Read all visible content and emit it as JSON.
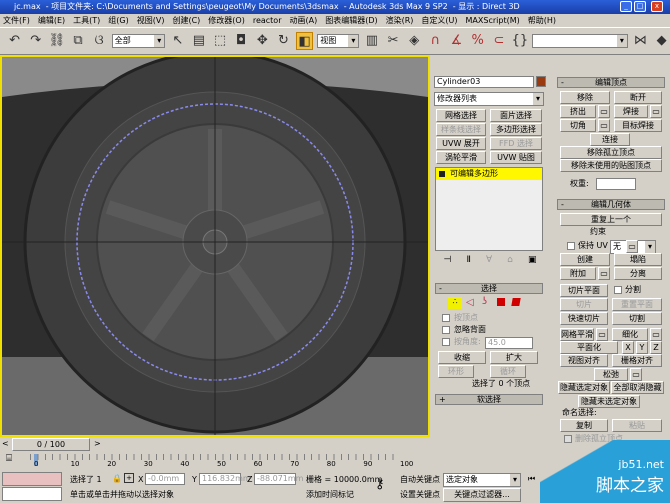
{
  "title": {
    "file": "jc.max",
    "project": "- 项目文件夹: C:\\Documents and Settings\\peugeot\\My Documents\\3dsmax",
    "app": "- Autodesk 3ds Max 9 SP2",
    "display": "- 显示 : Direct 3D"
  },
  "menu": [
    "文件(F)",
    "编辑(E)",
    "工具(T)",
    "组(G)",
    "视图(V)",
    "创建(C)",
    "修改器(O)",
    "reactor",
    "动画(A)",
    "图表编辑器(D)",
    "渲染(R)",
    "自定义(U)",
    "MAXScript(M)",
    "帮助(H)"
  ],
  "toolbar": {
    "selection_filter": "全部",
    "coord_system": "视图",
    "named_selection": ""
  },
  "modify": {
    "object_name": "Cylinder03",
    "object_color": "#9a3a10",
    "modifier_list": "修改器列表",
    "buttons": [
      "网格选择",
      "面片选择",
      "样条线选择",
      "多边形选择",
      "UVW 展开",
      "FFD 选择",
      "涡轮平滑",
      "UVW 贴图"
    ],
    "stack_item": "可编辑多边形"
  },
  "selection": {
    "title": "选择",
    "by_vertex": "按顶点",
    "ignore_backfacing": "忽略背面",
    "by_angle": "按角度:",
    "angle_value": "45.0",
    "shrink": "收缩",
    "grow": "扩大",
    "ring": "环形",
    "loop": "循环",
    "status": "选择了 0 个顶点",
    "soft_selection": "软选择"
  },
  "edit_vertices": {
    "title": "编辑顶点",
    "remove": "移除",
    "break": "断开",
    "extrude": "挤出",
    "weld": "焊接",
    "chamfer": "切角",
    "target_weld": "目标焊接",
    "connect": "连接",
    "remove_isolated": "移除孤立顶点",
    "remove_unused_map": "移除未使用的贴图顶点",
    "weight": "权重:"
  },
  "edit_geometry": {
    "title": "编辑几何体",
    "repeat_last": "重复上一个",
    "constraints": "约束",
    "constraint_value": "无",
    "preserve_uvs": "保持 UV",
    "create": "创建",
    "collapse": "塌陷",
    "attach": "附加",
    "detach": "分离",
    "slice_plane": "切片平面",
    "split": "分割",
    "slice": "切片",
    "reset_plane": "重置平面",
    "quickslice": "快速切片",
    "cut": "切割",
    "meshsmooth": "网格平滑",
    "tessellate": "细化",
    "make_planar": "平面化",
    "x": "X",
    "y": "Y",
    "z": "Z",
    "view_align": "视图对齐",
    "grid_align": "栅格对齐",
    "relax": "松弛",
    "hide_selected": "隐藏选定对象",
    "unhide_all": "全部取消隐藏",
    "hide_unselected": "隐藏未选定对象",
    "named_selections": "命名选择:",
    "copy": "复制",
    "paste": "粘贴",
    "delete_isolated": "删除孤立顶点"
  },
  "timeline": {
    "frame": "0 / 100",
    "ticks": [
      "0",
      "10",
      "20",
      "30",
      "40",
      "50",
      "60",
      "70",
      "80",
      "90",
      "100"
    ]
  },
  "status": {
    "selected": "选择了 1",
    "x_label": "X",
    "x": "-0.0mm",
    "y_label": "Y",
    "y": "116.832mm",
    "z_label": "Z",
    "z": "-88.071mm",
    "grid": "栅格 = 10000.0mm",
    "prompt": "单击或单击并拖动以选择对象",
    "add_time_tag": "添加时间标记",
    "auto_key": "自动关键点",
    "key_mode": "选定对象",
    "set_key": "设置关键点",
    "key_filters": "关键点过滤器..."
  },
  "watermark": {
    "site": "jb51.net",
    "name": "脚本之家"
  }
}
